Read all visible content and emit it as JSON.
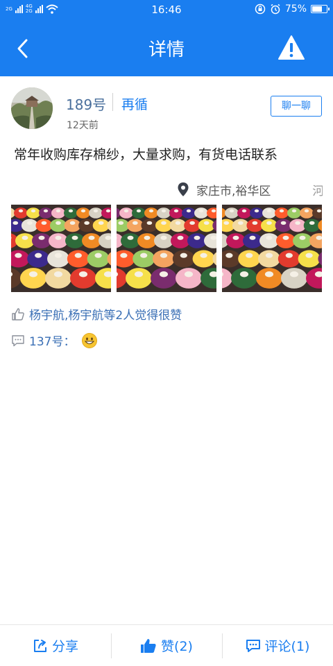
{
  "status_bar": {
    "time": "16:46",
    "network_labels": [
      "2G",
      "4G",
      "2G"
    ],
    "battery": "75%",
    "battery_level": 0.75,
    "icons": [
      "signal-icon",
      "wifi-icon",
      "lock-rotation-icon",
      "alarm-icon",
      "battery-icon"
    ]
  },
  "nav": {
    "title": "详情",
    "back_icon": "chevron-left-icon",
    "report_icon": "warning-icon"
  },
  "post": {
    "username": "189号",
    "nickname": "再循",
    "time_ago": "12天前",
    "chat_button": "聊一聊",
    "content": "常年收购库存棉纱，大量求购，有货电话联系",
    "location": "家庄市,裕华区",
    "location_extra": "河",
    "photo_count": 3,
    "likes_text": "杨宇航,杨宇航等2人觉得很赞",
    "comment_user": "137号：",
    "comment_emoji": "grinning-emoji"
  },
  "bottom_bar": {
    "share": "分享",
    "like": "赞(2)",
    "comment": "评论(1)"
  },
  "colors": {
    "primary": "#1a7ef0",
    "link": "#3a6fb5"
  }
}
